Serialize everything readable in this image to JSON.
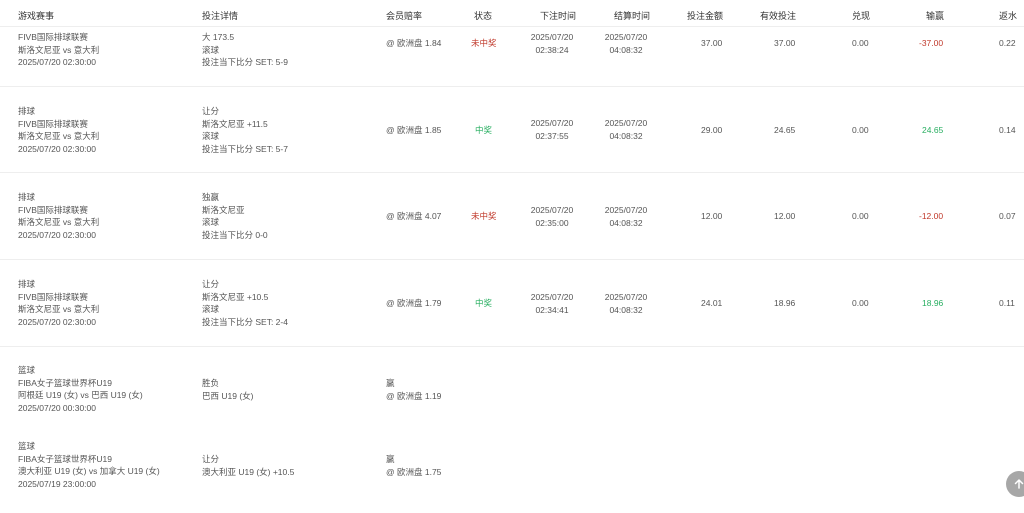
{
  "headers": [
    "游戏赛事",
    "投注详情",
    "会员赔率",
    "状态",
    "下注时间",
    "结算时间",
    "投注金额",
    "有效投注",
    "兑现",
    "输赢",
    "返水"
  ],
  "rows": [
    {
      "event": [
        "FIVB国际排球联赛",
        "斯洛文尼亚 vs 意大利",
        "2025/07/20 02:30:00"
      ],
      "detail": [
        "大 173.5",
        "滚球",
        "投注当下比分 SET: 5-9"
      ],
      "odds": "@ 欧洲盘 1.84",
      "status": "未中奖",
      "bet_time": [
        "2025/07/20",
        "02:38:24"
      ],
      "settle_time": [
        "2025/07/20",
        "04:08:32"
      ],
      "amount": "37.00",
      "valid": "37.00",
      "cashout": "0.00",
      "winloss": "-37.00",
      "rebate": "0.22"
    },
    {
      "event": [
        "排球",
        "FIVB国际排球联赛",
        "斯洛文尼亚 vs 意大利",
        "2025/07/20 02:30:00"
      ],
      "detail": [
        "让分",
        "斯洛文尼亚 +11.5",
        "滚球",
        "投注当下比分 SET: 5-7"
      ],
      "odds": "@ 欧洲盘 1.85",
      "status": "中奖",
      "bet_time": [
        "2025/07/20",
        "02:37:55"
      ],
      "settle_time": [
        "2025/07/20",
        "04:08:32"
      ],
      "amount": "29.00",
      "valid": "24.65",
      "cashout": "0.00",
      "winloss": "24.65",
      "rebate": "0.14"
    },
    {
      "event": [
        "排球",
        "FIVB国际排球联赛",
        "斯洛文尼亚 vs 意大利",
        "2025/07/20 02:30:00"
      ],
      "detail": [
        "独赢",
        "斯洛文尼亚",
        "滚球",
        "投注当下比分 0-0"
      ],
      "odds": "@ 欧洲盘 4.07",
      "status": "未中奖",
      "bet_time": [
        "2025/07/20",
        "02:35:00"
      ],
      "settle_time": [
        "2025/07/20",
        "04:08:32"
      ],
      "amount": "12.00",
      "valid": "12.00",
      "cashout": "0.00",
      "winloss": "-12.00",
      "rebate": "0.07"
    },
    {
      "event": [
        "排球",
        "FIVB国际排球联赛",
        "斯洛文尼亚 vs 意大利",
        "2025/07/20 02:30:00"
      ],
      "detail": [
        "让分",
        "斯洛文尼亚 +10.5",
        "滚球",
        "投注当下比分 SET: 2-4"
      ],
      "odds": "@ 欧洲盘 1.79",
      "status": "中奖",
      "bet_time": [
        "2025/07/20",
        "02:34:41"
      ],
      "settle_time": [
        "2025/07/20",
        "04:08:32"
      ],
      "amount": "24.01",
      "valid": "18.96",
      "cashout": "0.00",
      "winloss": "18.96",
      "rebate": "0.11"
    }
  ],
  "parlay": [
    {
      "event": [
        "篮球",
        "FIBA女子篮球世界杯U19",
        "阿根廷 U19 (女) vs 巴西 U19 (女)",
        "2025/07/20 00:30:00"
      ],
      "detail": [
        "胜负",
        "巴西 U19 (女)"
      ],
      "odds": [
        "赢",
        "@ 欧洲盘 1.19"
      ]
    },
    {
      "event": [
        "篮球",
        "FIBA女子篮球世界杯U19",
        "澳大利亚 U19 (女) vs 加拿大 U19 (女)",
        "2025/07/19 23:00:00"
      ],
      "detail": [
        "让分",
        "澳大利亚 U19 (女) +10.5"
      ],
      "odds": [
        "赢",
        "@ 欧洲盘 1.75"
      ]
    }
  ],
  "scroll_top_icon": "arrow-up-icon"
}
